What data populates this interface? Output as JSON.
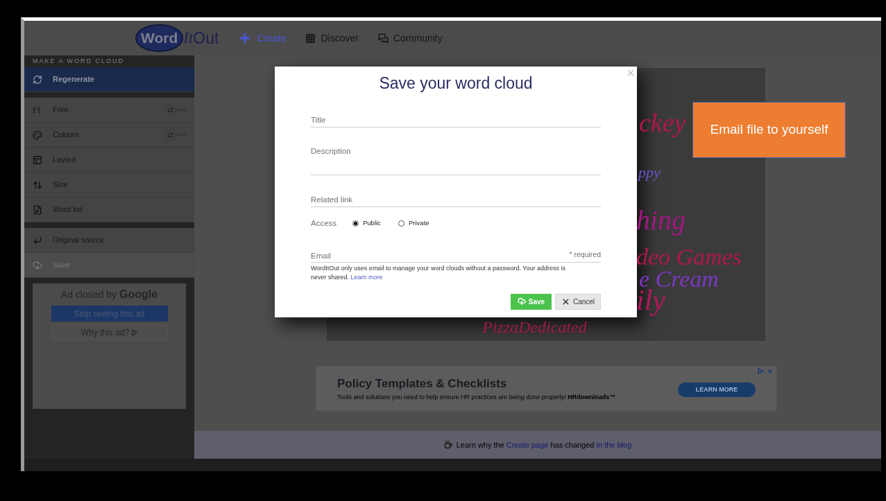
{
  "nav": {
    "logo": {
      "word": "Word",
      "it": "It",
      "out": "Out"
    },
    "links": [
      {
        "label": "Create",
        "selected": true
      },
      {
        "label": "Discover",
        "selected": false
      },
      {
        "label": "Community",
        "selected": false
      }
    ]
  },
  "sidebar": {
    "heading": "MAKE A WORD CLOUD",
    "groups": [
      [
        {
          "label": "Regenerate",
          "selected": true,
          "disabled": false
        }
      ],
      [
        {
          "label": "Font",
          "selected": false,
          "disabled": false,
          "toggle_on": false,
          "icon_text": "Ff"
        },
        {
          "label": "Colours",
          "selected": false,
          "disabled": false,
          "toggle_on": false
        },
        {
          "label": "Layout",
          "selected": false,
          "disabled": false
        },
        {
          "label": "Size",
          "selected": false,
          "disabled": false
        },
        {
          "label": "Word list",
          "selected": false,
          "disabled": false
        }
      ],
      [
        {
          "label": "Original source",
          "selected": false,
          "disabled": false
        },
        {
          "label": "Save",
          "selected": false,
          "disabled": true
        }
      ]
    ]
  },
  "side_ad": {
    "prefix": "Ad closed by",
    "brand": "Google",
    "stop": "Stop seeing this ad",
    "why": "Why this ad?"
  },
  "cloud": {
    "words": [
      {
        "text": "ckey",
        "color": "#b01848"
      },
      {
        "text": "ppy",
        "color": "#6a58c8"
      },
      {
        "text": "hing",
        "color": "#a01880"
      },
      {
        "text": "deo Games",
        "color": "#b01848"
      },
      {
        "text": "e Cream",
        "color": "#7a38c0"
      },
      {
        "text": "ily",
        "color": "#b0185a"
      },
      {
        "text": "PizzaDedicated",
        "color": "#a01848"
      }
    ]
  },
  "banner_ad": {
    "title": "Policy Templates & Checklists",
    "text": "Tools and solutions you need to help ensure HR practices are being done properly! **HRdownloads™**",
    "button": "LEARN MORE"
  },
  "footer": {
    "parts": [
      {
        "text": "Learn why the",
        "link": false
      },
      {
        "text": "Create page",
        "link": true
      },
      {
        "text": "has changed",
        "link": false
      },
      {
        "text": "in the blog",
        "link": true
      }
    ]
  },
  "dialog": {
    "title": "Save your word cloud",
    "close": "×",
    "fields": [
      {
        "placeholder": "Title",
        "kind": "line"
      },
      {
        "placeholder": "Description",
        "kind": "area"
      },
      {
        "placeholder": "Related link",
        "kind": "line"
      }
    ],
    "access": {
      "label": "Access",
      "options": [
        {
          "label": "Public",
          "selected": true
        },
        {
          "label": "Private",
          "selected": false
        }
      ]
    },
    "email": {
      "placeholder": "Email",
      "required": "* required",
      "note": "WordItOut only uses email to manage your word clouds without a password. Your address is never shared.",
      "link": "Learn more"
    },
    "save": "Save",
    "cancel": "Cancel"
  },
  "callout": {
    "text": "Email file to yourself"
  }
}
